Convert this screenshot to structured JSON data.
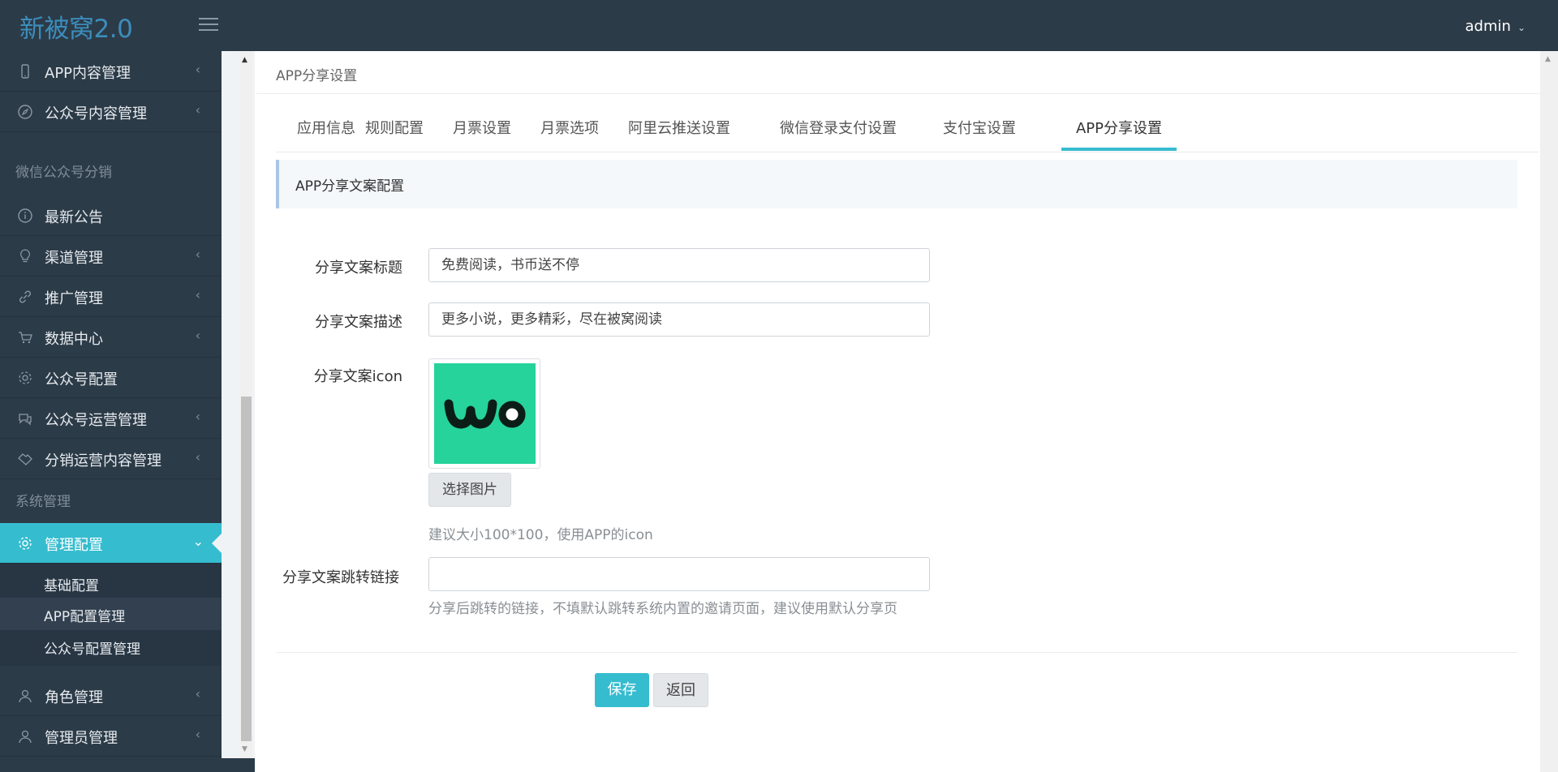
{
  "app": {
    "logo": "新被窝2.0",
    "user": "admin"
  },
  "sidebar": {
    "items": [
      {
        "label": "APP内容管理",
        "icon": "phone-icon"
      },
      {
        "label": "公众号内容管理",
        "icon": "compass-icon"
      },
      {
        "header": "微信公众号分销"
      },
      {
        "label": "最新公告",
        "icon": "info-icon"
      },
      {
        "label": "渠道管理",
        "icon": "bulb-icon"
      },
      {
        "label": "推广管理",
        "icon": "link-icon"
      },
      {
        "label": "数据中心",
        "icon": "cart-icon"
      },
      {
        "label": "公众号配置",
        "icon": "gear-icon"
      },
      {
        "label": "公众号运营管理",
        "icon": "chat-icon"
      },
      {
        "label": "分销运营内容管理",
        "icon": "handshake-icon"
      },
      {
        "header": "系统管理"
      },
      {
        "label": "管理配置",
        "icon": "gear-icon",
        "active": true
      },
      {
        "label": "角色管理",
        "icon": "user-icon"
      },
      {
        "label": "管理员管理",
        "icon": "user-icon"
      }
    ],
    "submenu": [
      "基础配置",
      "APP配置管理",
      "公众号配置管理"
    ]
  },
  "main": {
    "page_title": "APP分享设置",
    "tabs": [
      "应用信息",
      "规则配置",
      "月票设置",
      "月票选项",
      "阿里云推送设置",
      "微信登录支付设置",
      "支付宝设置",
      "APP分享设置"
    ],
    "active_tab": "APP分享设置",
    "section_title": "APP分享文案配置",
    "form": {
      "title_label": "分享文案标题",
      "title_value": "免费阅读，书币送不停",
      "desc_label": "分享文案描述",
      "desc_value": "更多小说，更多精彩，尽在被窝阅读",
      "icon_label": "分享文案icon",
      "icon_text": "wo",
      "select_image": "选择图片",
      "icon_help": "建议大小100*100，使用APP的icon",
      "link_label": "分享文案跳转链接",
      "link_value": "",
      "link_help": "分享后跳转的链接，不填默认跳转系统内置的邀请页面，建议使用默认分享页"
    },
    "save_label": "保存",
    "back_label": "返回"
  },
  "colors": {
    "sidebar_bg": "#2c3b48",
    "accent": "#36bccf",
    "logo": "#3c8dbc",
    "icon_bg": "#25d39b"
  }
}
